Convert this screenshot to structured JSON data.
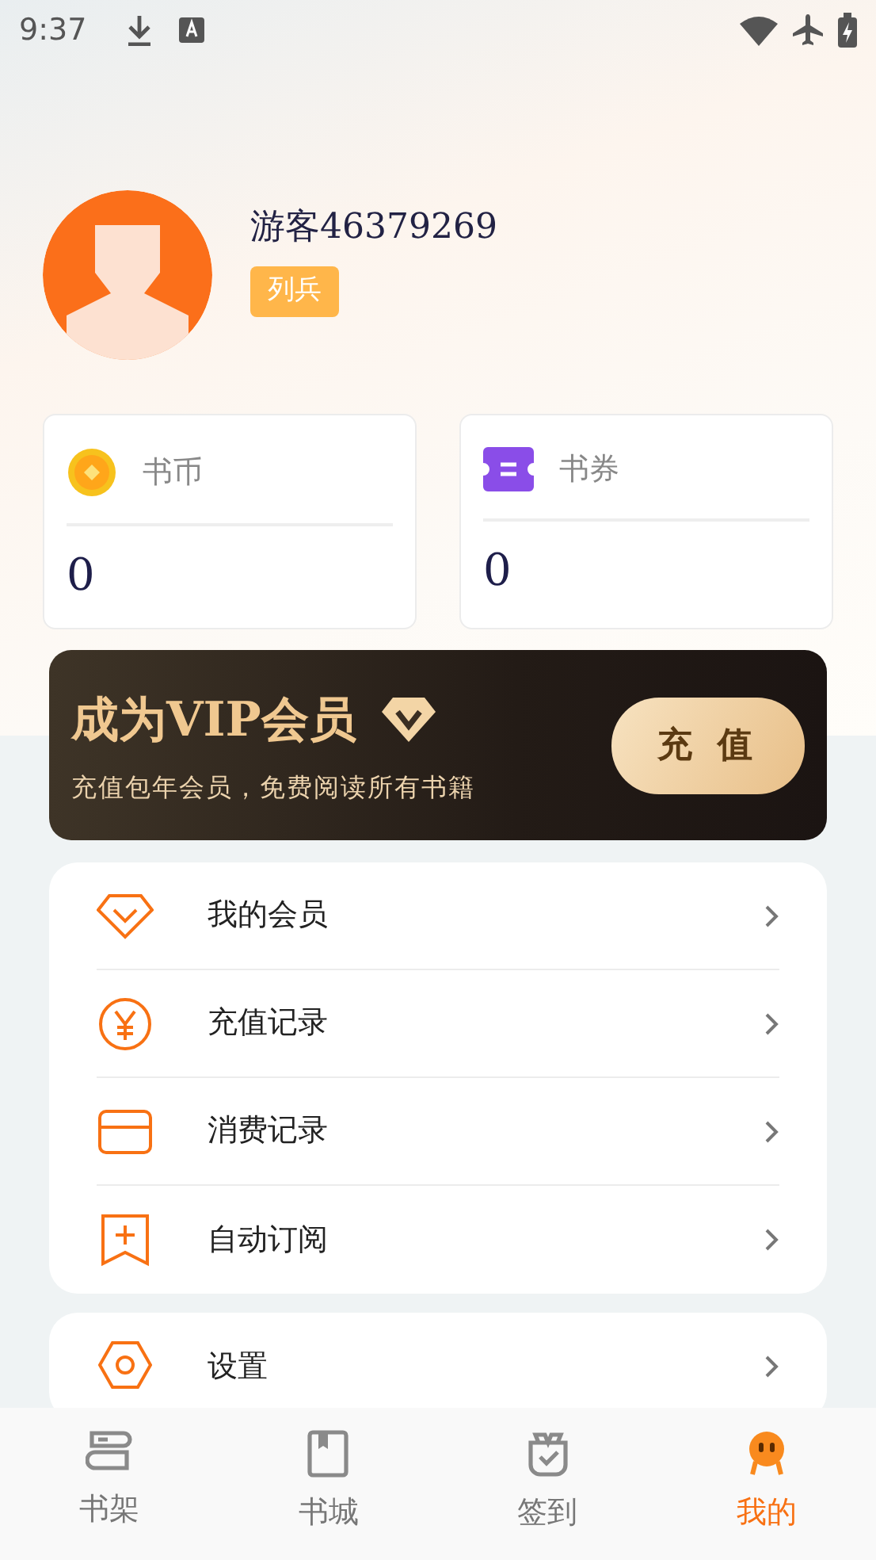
{
  "status_bar": {
    "time": "9:37"
  },
  "profile": {
    "name": "游客46379269",
    "rank": "列兵"
  },
  "wallet": [
    {
      "kind": "coin",
      "label": "书币",
      "value": "0"
    },
    {
      "kind": "ticket",
      "label": "书券",
      "value": "0"
    }
  ],
  "vip_banner": {
    "title": "成为VIP会员",
    "subtitle": "充值包年会员，免费阅读所有书籍",
    "button": "充 值"
  },
  "menu": [
    {
      "kind": "diamond",
      "label": "我的会员"
    },
    {
      "kind": "yen",
      "label": "充值记录"
    },
    {
      "kind": "card",
      "label": "消费记录"
    },
    {
      "kind": "subscribe",
      "label": "自动订阅"
    }
  ],
  "menu_2": [
    {
      "kind": "settings",
      "label": "设置"
    }
  ],
  "tab_bar": [
    {
      "kind": "shelf",
      "label": "书架",
      "selected": false
    },
    {
      "kind": "store",
      "label": "书城",
      "selected": false
    },
    {
      "kind": "checkin",
      "label": "签到",
      "selected": false
    },
    {
      "kind": "me",
      "label": "我的",
      "selected": true
    }
  ]
}
